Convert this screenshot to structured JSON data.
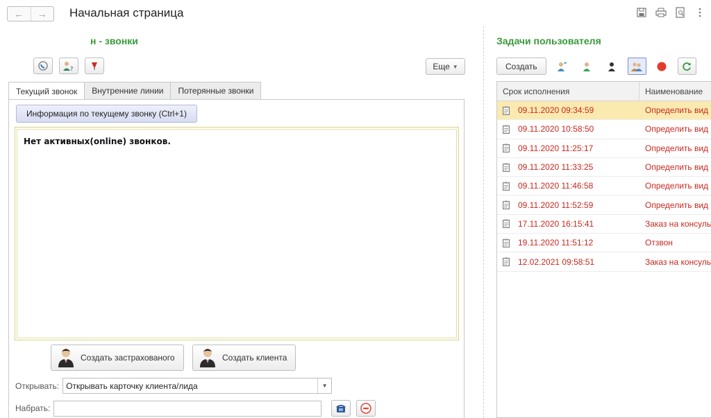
{
  "window": {
    "title": "Начальная страница"
  },
  "calls_panel": {
    "title": "н - звонки",
    "more_label": "Еще",
    "tabs": [
      {
        "label": "Текущий звонок"
      },
      {
        "label": "Внутренние линии"
      },
      {
        "label": "Потерянные звонки"
      }
    ],
    "info_button": "Информация по текущему звонку (Ctrl+1)",
    "no_calls_text": "Нет активных(online) звонков.",
    "create_insured_button": "Создать застрахованого",
    "create_client_button": "Создать клиента",
    "open_label": "Открывать:",
    "open_value": "Открывать карточку клиента/лида",
    "dial_label": "Набрать:",
    "dial_value": ""
  },
  "tasks_panel": {
    "title": "Задачи пользователя",
    "create_button": "Создать",
    "columns": [
      "Срок исполнения",
      "Наименование"
    ],
    "rows": [
      {
        "due": "09.11.2020 09:34:59",
        "name": "Определить вид",
        "selected": true
      },
      {
        "due": "09.11.2020 10:58:50",
        "name": "Определить вид",
        "selected": false
      },
      {
        "due": "09.11.2020 11:25:17",
        "name": "Определить вид",
        "selected": false
      },
      {
        "due": "09.11.2020 11:33:25",
        "name": "Определить вид",
        "selected": false
      },
      {
        "due": "09.11.2020 11:46:58",
        "name": "Определить вид",
        "selected": false
      },
      {
        "due": "09.11.2020 11:52:59",
        "name": "Определить вид",
        "selected": false
      },
      {
        "due": "17.11.2020 16:15:41",
        "name": "Заказ на консульт",
        "selected": false
      },
      {
        "due": "19.11.2020 11:51:12",
        "name": "Отзвон",
        "selected": false
      },
      {
        "due": "12.02.2021 09:58:51",
        "name": "Заказ на консульт",
        "selected": false
      }
    ]
  },
  "colors": {
    "accent_green": "#3a9a3a",
    "task_red": "#c8271f",
    "selected_row": "#fbeab0"
  }
}
